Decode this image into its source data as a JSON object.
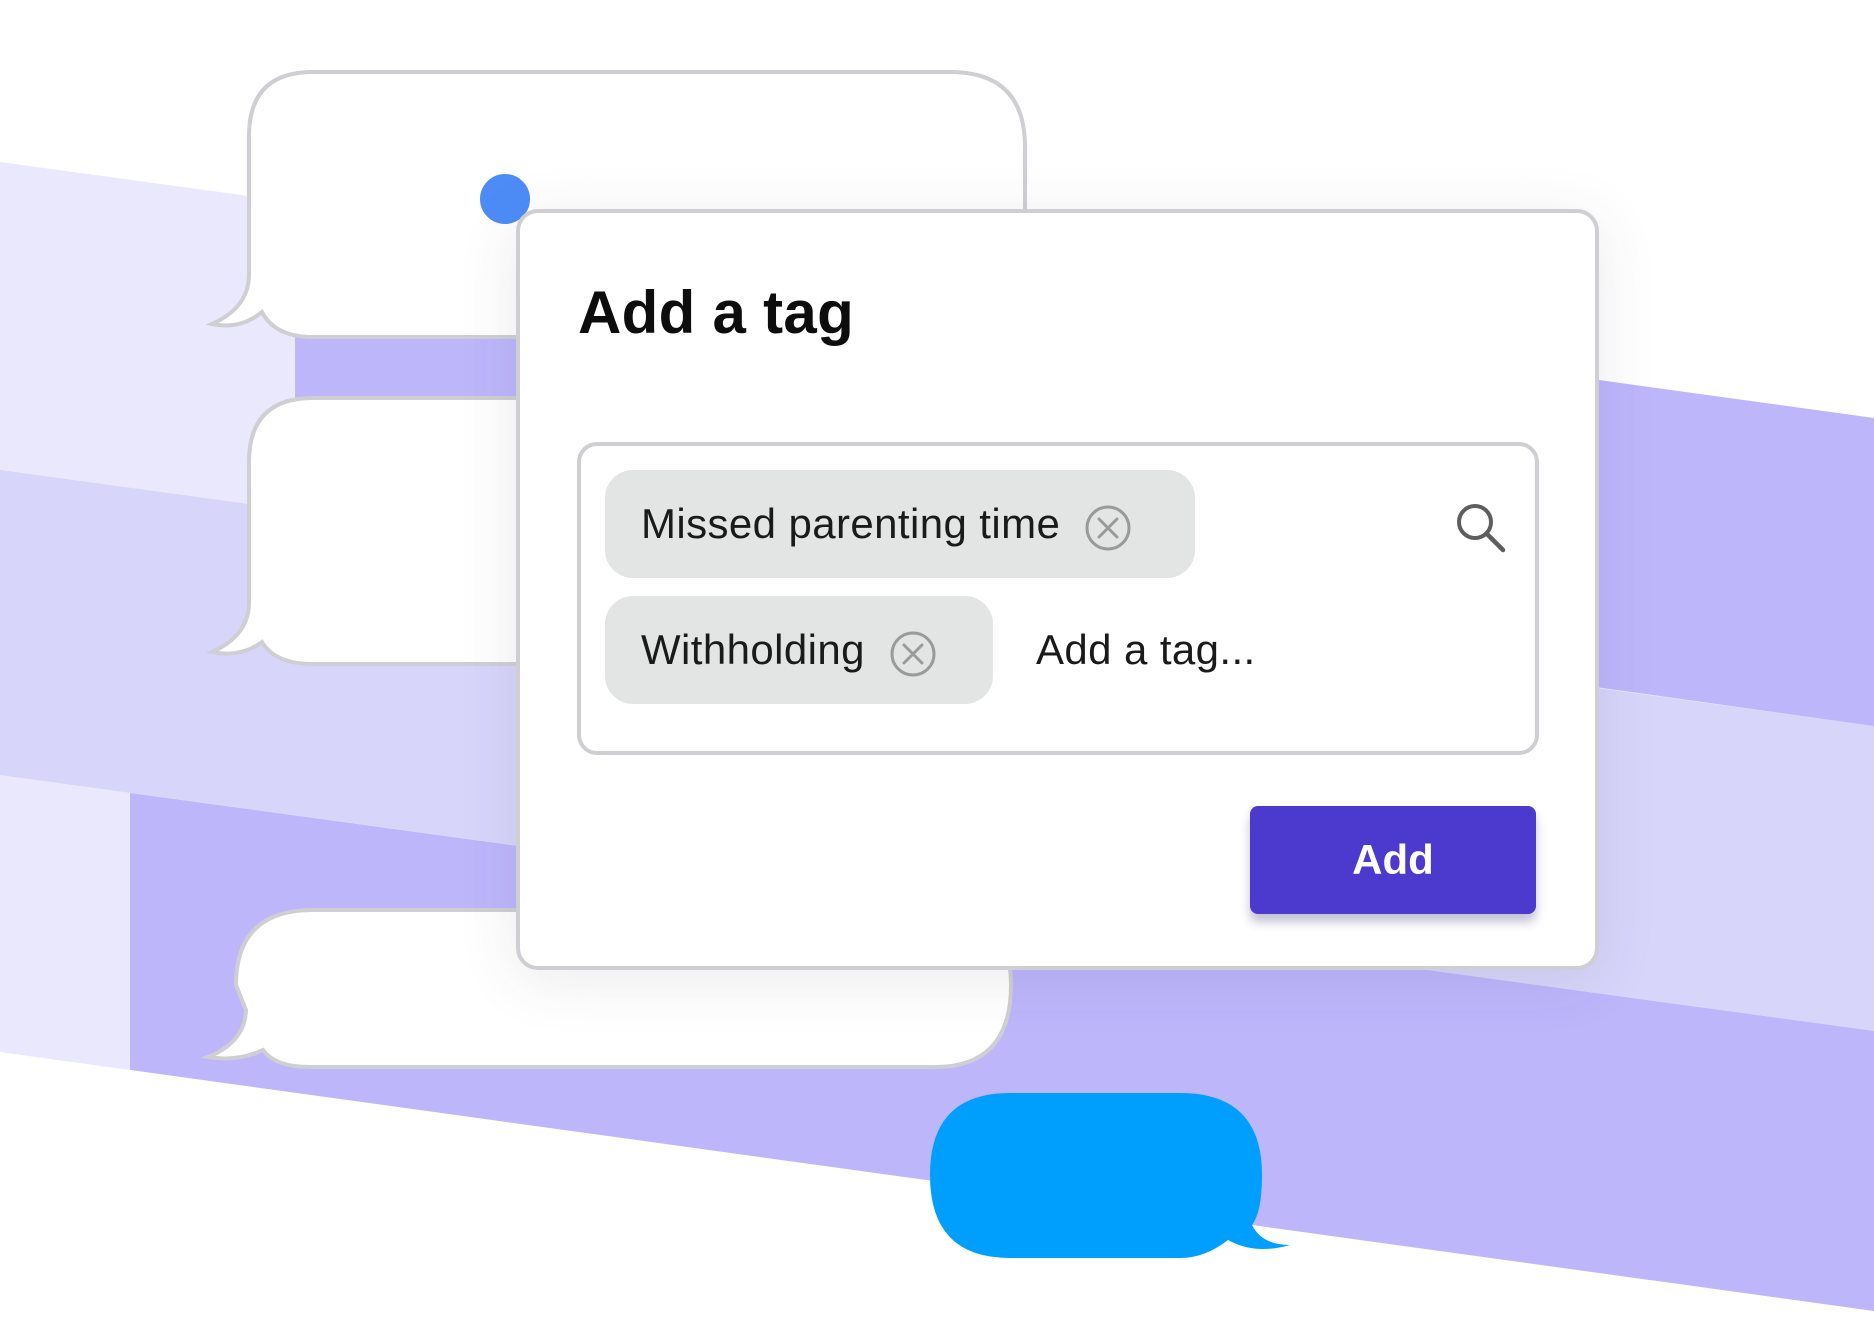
{
  "dialog": {
    "title": "Add a tag"
  },
  "tag_field": {
    "tags": [
      {
        "label": "Missed parenting time",
        "remove_icon": "close-circle-icon"
      },
      {
        "label": "Withholding",
        "remove_icon": "close-circle-icon"
      }
    ],
    "input_value": "",
    "input_placeholder": "Add a tag...",
    "search_icon": "search-icon"
  },
  "actions": {
    "add_label": "Add"
  },
  "colors": {
    "band_light": "#e9e8fd",
    "band_mid": "#d7d5fa",
    "band_strong": "#bdb6fb",
    "bubble_border": "#cfcfd3",
    "notification_dot": "#4d8cf7",
    "sent_bubble": "#009ffd",
    "primary_button": "#4b3acd",
    "chip_bg": "#e3e4e4"
  }
}
